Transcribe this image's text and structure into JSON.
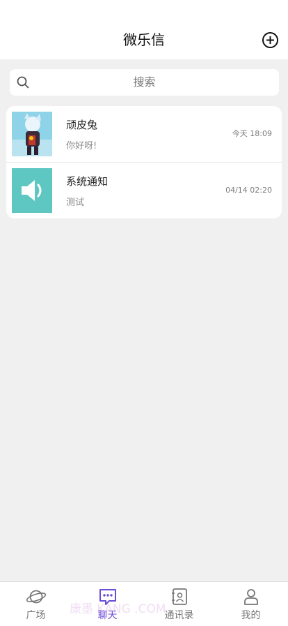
{
  "header": {
    "title": "微乐信",
    "add_icon": "plus-circle-icon"
  },
  "search": {
    "placeholder": "搜索",
    "icon": "search-icon"
  },
  "conversations": [
    {
      "name": "顽皮兔",
      "last_message": "你好呀!",
      "time": "今天 18:09",
      "avatar": "character-avatar"
    },
    {
      "name": "系统通知",
      "last_message": "测试",
      "time": "04/14 02:20",
      "avatar": "speaker-icon"
    }
  ],
  "tabs": [
    {
      "label": "广场",
      "icon": "planet-icon",
      "active": false
    },
    {
      "label": "聊天",
      "icon": "chat-bubble-icon",
      "active": true
    },
    {
      "label": "通讯录",
      "icon": "contacts-book-icon",
      "active": false
    },
    {
      "label": "我的",
      "icon": "person-icon",
      "active": false
    }
  ],
  "watermark": "康墨   KANG    .COM",
  "colors": {
    "accent": "#6a4bd6",
    "speaker_tile": "#5fc7c2",
    "background": "#f0f0f0"
  }
}
